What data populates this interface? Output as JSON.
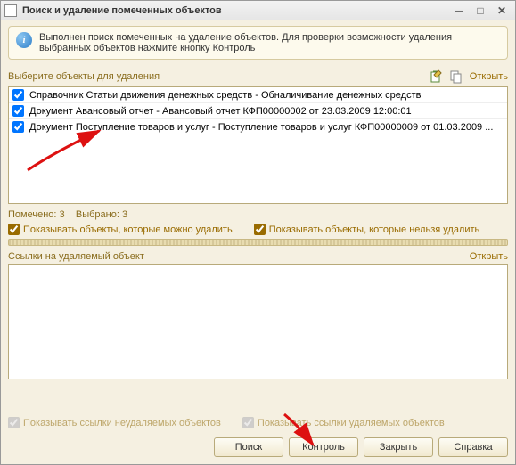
{
  "window": {
    "title": "Поиск и удаление помеченных объектов"
  },
  "info": {
    "text": "Выполнен поиск помеченных на удаление объектов. Для проверки возможности удаления выбранных объектов нажмите кнопку Контроль"
  },
  "selection": {
    "label": "Выберите объекты для удаления",
    "open": "Открыть",
    "items": [
      {
        "checked": true,
        "text": "Справочник Статьи движения денежных средств - Обналичивание денежных средств"
      },
      {
        "checked": true,
        "text": "Документ Авансовый отчет - Авансовый отчет КФП00000002 от 23.03.2009 12:00:01"
      },
      {
        "checked": true,
        "text": "Документ Поступление товаров и услуг - Поступление товаров и услуг КФП00000009 от 01.03.2009 ..."
      }
    ]
  },
  "status": {
    "marked_label": "Помечено:",
    "marked_count": "3",
    "selected_label": "Выбрано:",
    "selected_count": "3"
  },
  "filters_top": {
    "show_can_delete": "Показывать объекты, которые можно удалить",
    "show_cannot_delete": "Показывать объекты, которые нельзя удалить"
  },
  "refs": {
    "label": "Ссылки на удаляемый объект",
    "open": "Открыть"
  },
  "filters_bottom": {
    "show_undeletable_refs": "Показывать ссылки неудаляемых объектов",
    "show_deletable_refs": "Показывать ссылки удаляемых объектов"
  },
  "buttons": {
    "search": "Поиск",
    "control": "Контроль",
    "close": "Закрыть",
    "help": "Справка"
  }
}
